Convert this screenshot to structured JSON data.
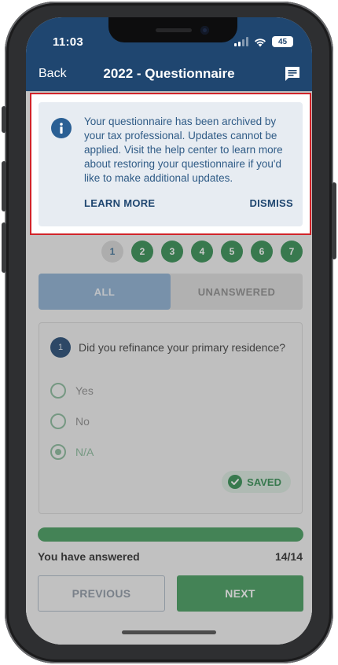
{
  "status": {
    "time": "11:03",
    "battery": "45"
  },
  "nav": {
    "back": "Back",
    "title": "2022 - Questionnaire"
  },
  "alert": {
    "message": "Your questionnaire has been archived by your tax professional. Updates cannot be applied. Visit the help center to learn more about restoring your questionnaire if you'd like to make additional updates.",
    "learn_more": "LEARN MORE",
    "dismiss": "DISMISS"
  },
  "steps": [
    "1",
    "2",
    "3",
    "4",
    "5",
    "6",
    "7"
  ],
  "tabs": {
    "all": "ALL",
    "unanswered": "UNANSWERED"
  },
  "question": {
    "number": "1",
    "text": "Did you refinance your primary residence?",
    "options": [
      "Yes",
      "No",
      "N/A"
    ],
    "selected": "N/A",
    "saved": "SAVED"
  },
  "progress": {
    "label": "You have answered",
    "count": "14/14",
    "fraction": 1.0
  },
  "buttons": {
    "previous": "PREVIOUS",
    "next": "NEXT"
  },
  "colors": {
    "header": "#1f4670",
    "accent_green": "#3f9a5a",
    "highlight_border": "#d1242a"
  }
}
